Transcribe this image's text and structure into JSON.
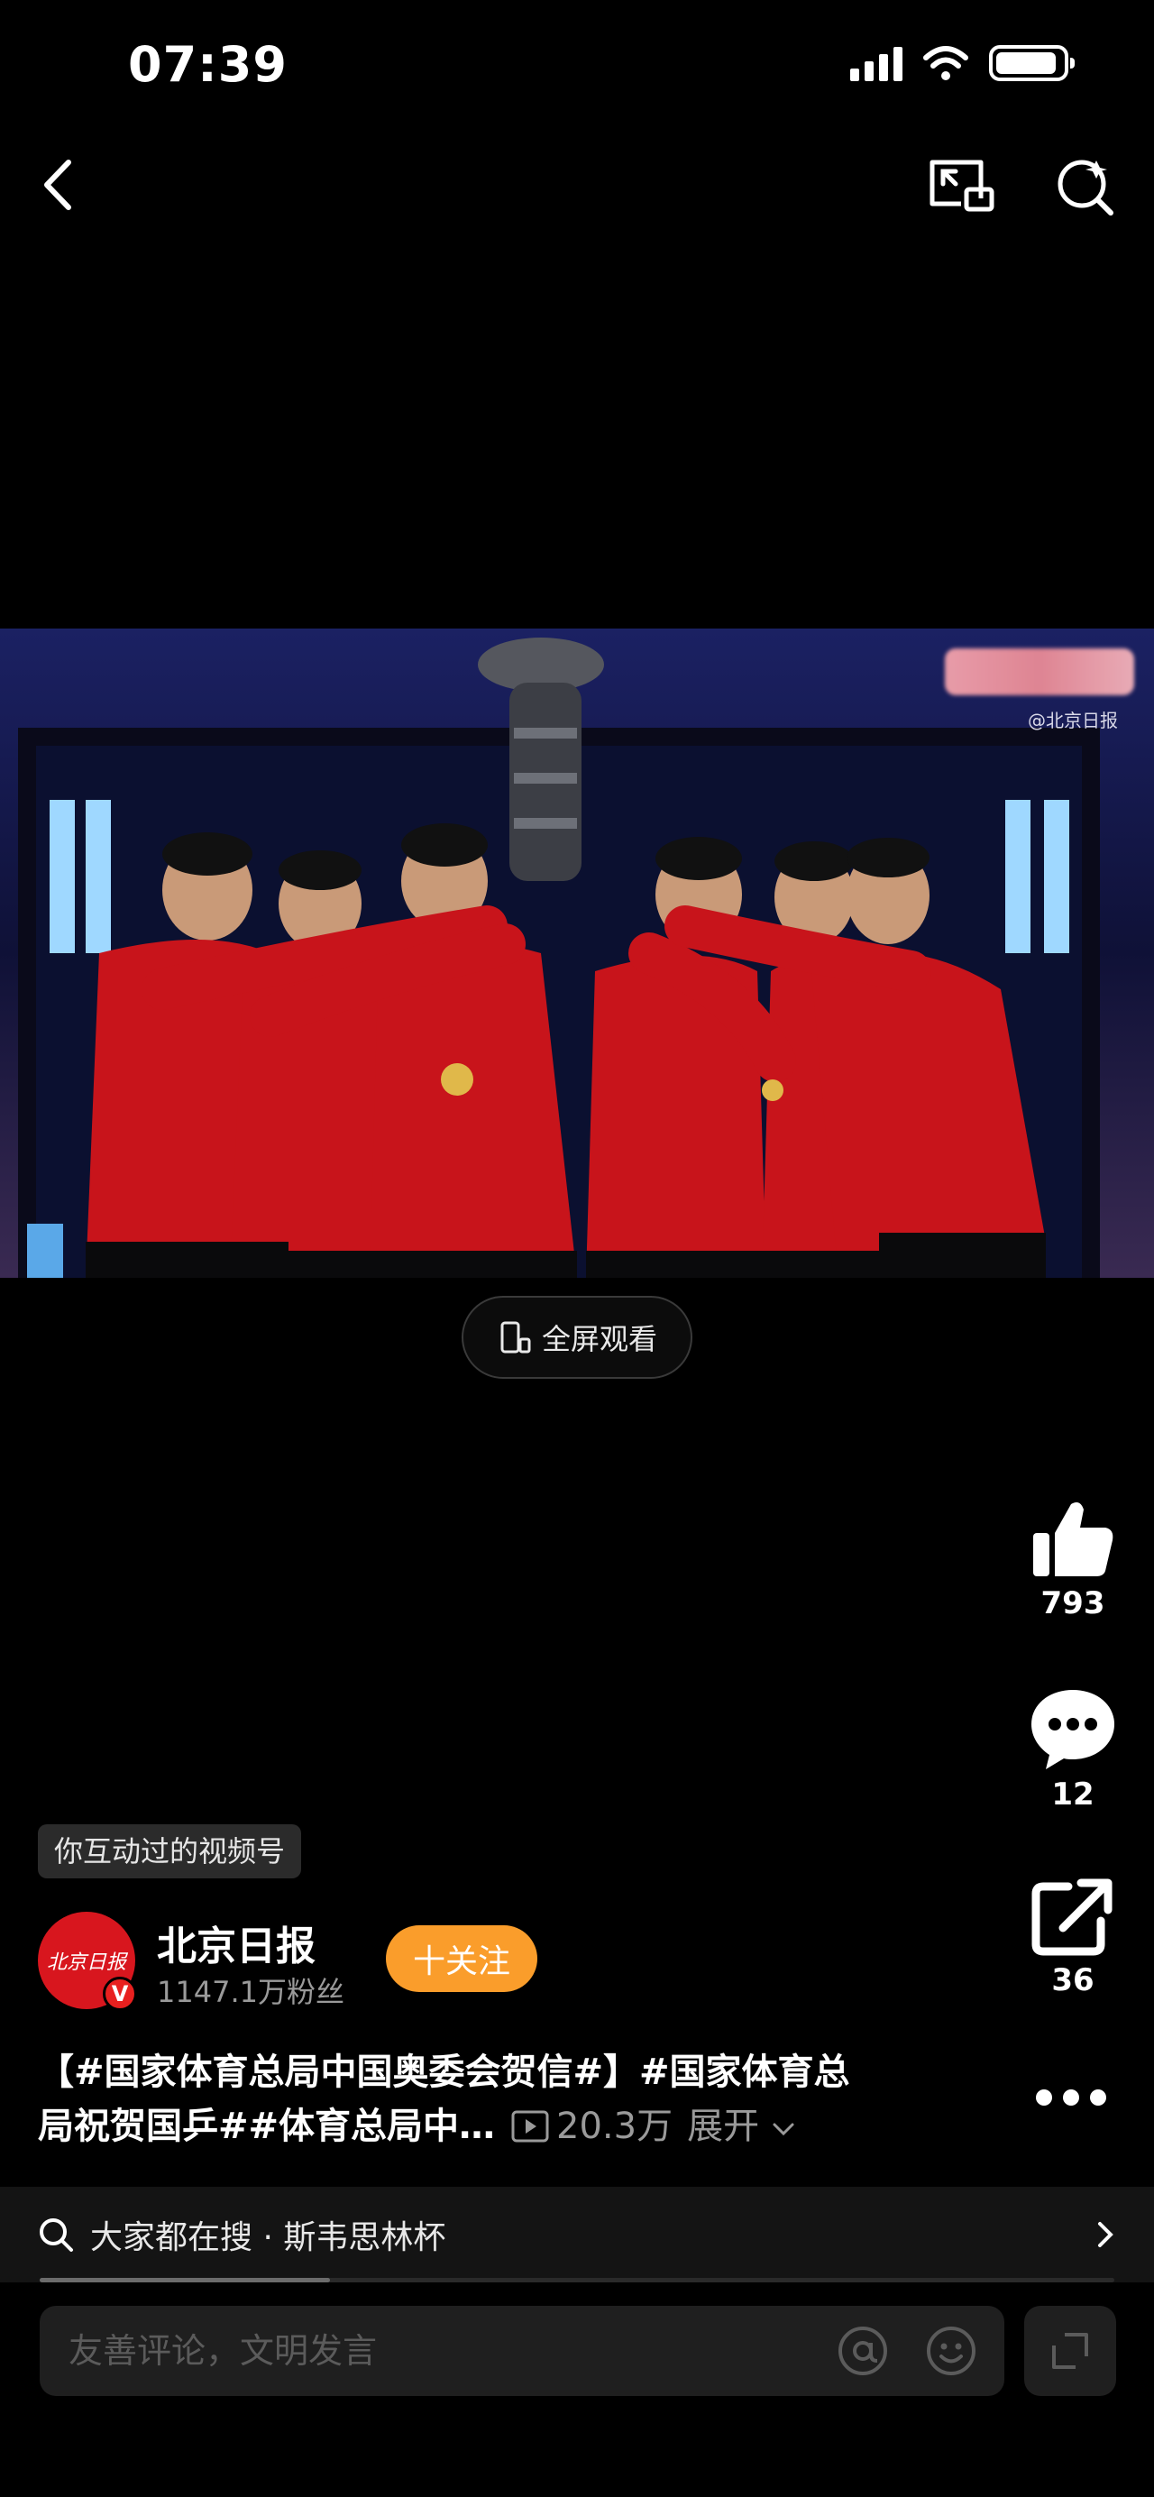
{
  "status_bar": {
    "time": "07:39"
  },
  "video": {
    "watermark": "@北京日报",
    "fullscreen_label": "全屏观看"
  },
  "actions": {
    "likes": "793",
    "comments": "12",
    "shares": "36"
  },
  "account": {
    "tag": "你互动过的视频号",
    "name": "北京日报",
    "fans": "1147.1万粉丝",
    "avatar_text": "北京日报",
    "verified_badge": "V",
    "follow_label": "十关注"
  },
  "post": {
    "line1": "【#国家体育总局中国奥委会贺信#】#国家体育总",
    "line2": "局祝贺国乒##体育总局中…",
    "views": "20.3万",
    "expand": "展开"
  },
  "search": {
    "text": "大家都在搜 · 斯韦思林杯",
    "progress": 0.27
  },
  "comment": {
    "placeholder": "友善评论，文明发言"
  },
  "colors": {
    "follow": "#fa9d2b",
    "avatar": "#d8161e",
    "background": "#000000"
  }
}
